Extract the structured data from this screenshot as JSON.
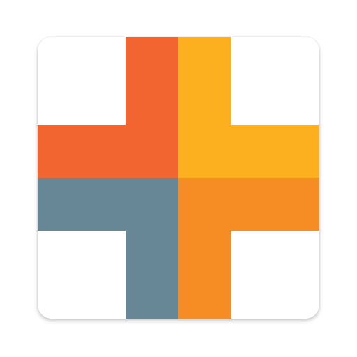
{
  "icon": {
    "name": "plus-cross-logo-icon",
    "colors": {
      "background": "#ffffff",
      "top_left": "#f26430",
      "top_right": "#fdb01f",
      "bottom_left": "#678797",
      "bottom_right": "#f68d24"
    }
  }
}
